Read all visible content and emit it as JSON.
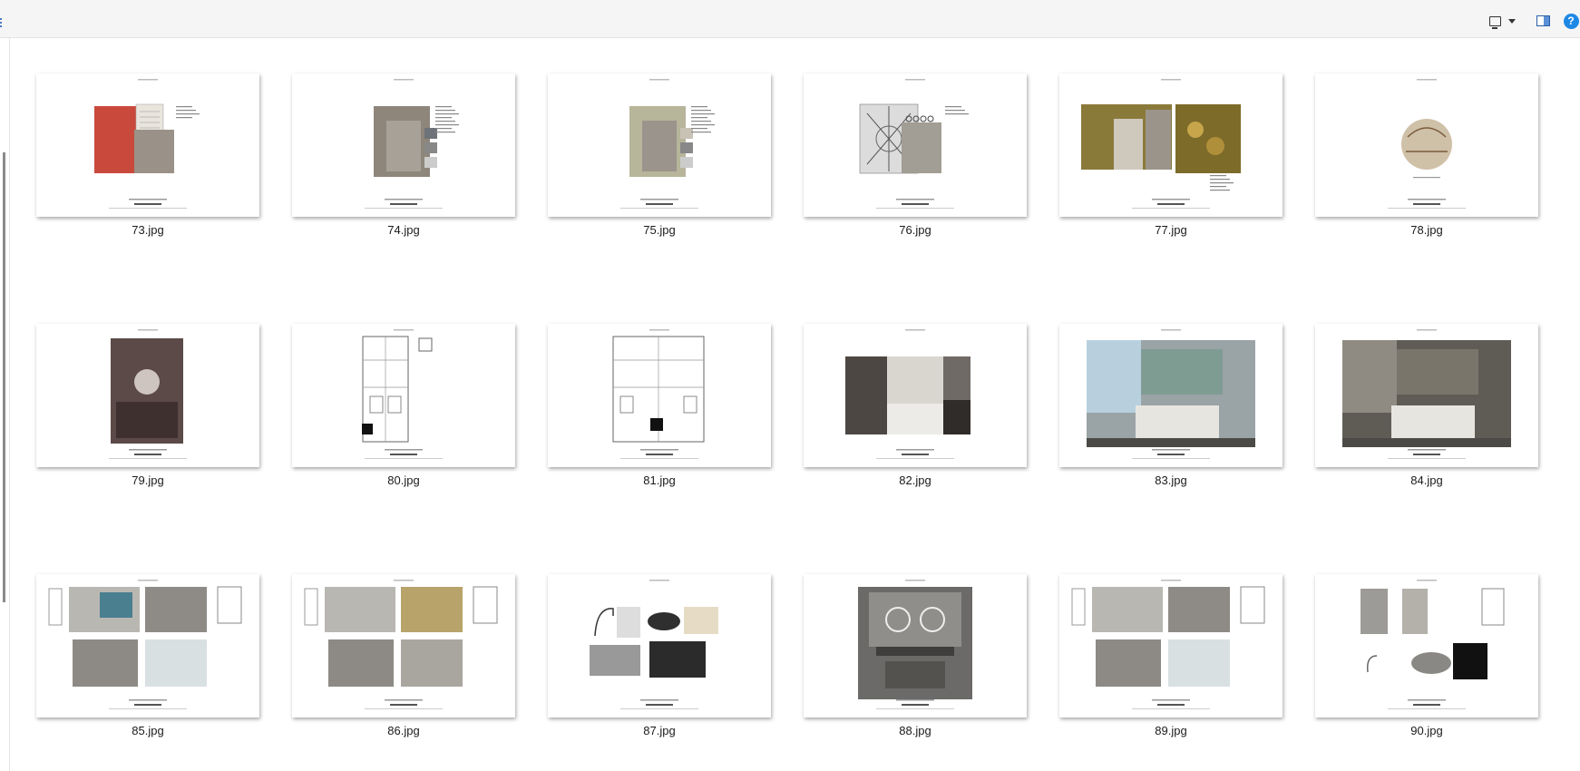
{
  "toolbar": {
    "view_icon": "monitor-icon",
    "view_dropdown_icon": "chevron-down-icon",
    "pane_icon": "preview-pane-icon",
    "help_label": "?"
  },
  "files": [
    {
      "name": "73.jpg",
      "kind": "material-swatches"
    },
    {
      "name": "74.jpg",
      "kind": "material-swatches"
    },
    {
      "name": "75.jpg",
      "kind": "material-swatches"
    },
    {
      "name": "76.jpg",
      "kind": "material-swatches"
    },
    {
      "name": "77.jpg",
      "kind": "material-swatches"
    },
    {
      "name": "78.jpg",
      "kind": "circle-detail"
    },
    {
      "name": "79.jpg",
      "kind": "photo-portrait"
    },
    {
      "name": "80.jpg",
      "kind": "floor-plan"
    },
    {
      "name": "81.jpg",
      "kind": "floor-plan"
    },
    {
      "name": "82.jpg",
      "kind": "mood-collage"
    },
    {
      "name": "83.jpg",
      "kind": "render"
    },
    {
      "name": "84.jpg",
      "kind": "render"
    },
    {
      "name": "85.jpg",
      "kind": "elevations"
    },
    {
      "name": "86.jpg",
      "kind": "elevations"
    },
    {
      "name": "87.jpg",
      "kind": "fixtures"
    },
    {
      "name": "88.jpg",
      "kind": "bath-render"
    },
    {
      "name": "89.jpg",
      "kind": "elevations"
    },
    {
      "name": "90.jpg",
      "kind": "fixtures"
    }
  ]
}
